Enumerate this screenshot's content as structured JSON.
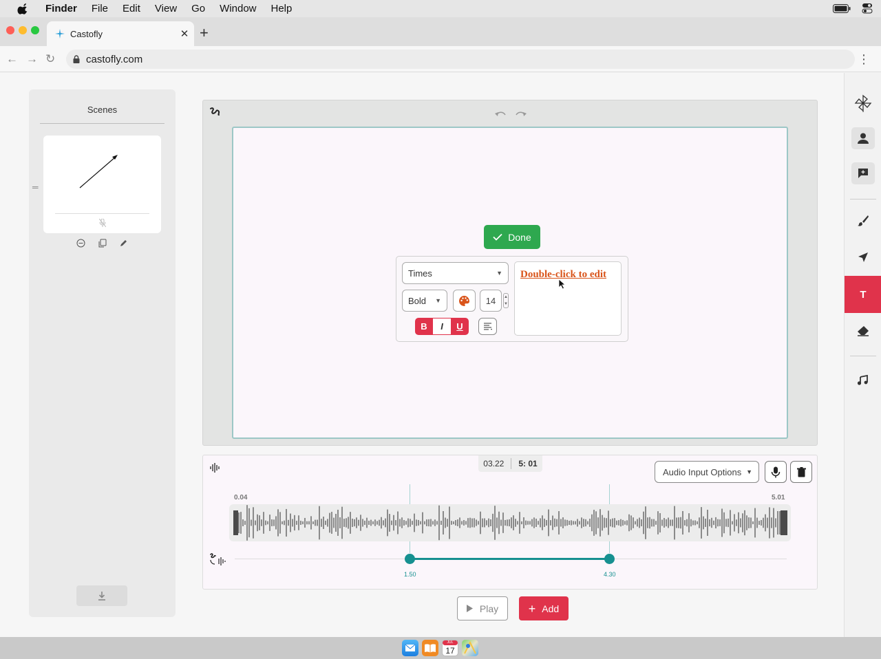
{
  "menubar": {
    "app_name": "Finder",
    "items": [
      "File",
      "Edit",
      "View",
      "Go",
      "Window",
      "Help"
    ]
  },
  "browser": {
    "tab_title": "Castofly",
    "url": "castofly.com"
  },
  "scenes": {
    "title": "Scenes"
  },
  "editor": {
    "done_label": "Done",
    "font_family": "Times",
    "font_weight": "Bold",
    "font_size": "14",
    "bold_label": "B",
    "italic_label": "I",
    "underline_label": "U",
    "preview_text": "Double-click to edit",
    "text_color": "#d9541a"
  },
  "audio": {
    "current_time": "03.22",
    "total_time": "5: 01",
    "input_options_label": "Audio Input Options",
    "range_start": "0.04",
    "range_end": "5.01",
    "selection_start": "1.50",
    "selection_end": "4.30"
  },
  "controls": {
    "play_label": "Play",
    "add_label": "Add"
  },
  "toolbar": {
    "tools": [
      "pinwheel-icon",
      "person-icon",
      "comment-icon",
      "brush-icon",
      "pointer-icon",
      "text-icon",
      "eraser-icon",
      "music-icon"
    ],
    "active_tool": "text-icon",
    "text_tool_label": "T"
  },
  "dock": {
    "calendar_month": "JUL",
    "calendar_day": "17"
  },
  "colors": {
    "accent_red": "#e0334b",
    "done_green": "#2ea84f",
    "teal": "#169090"
  }
}
